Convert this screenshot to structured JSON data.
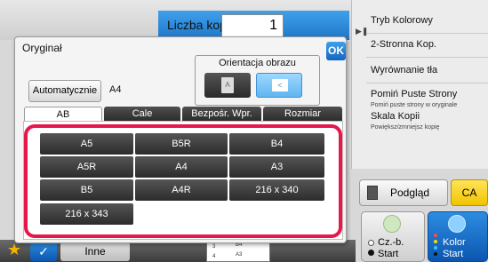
{
  "copies": {
    "label": "Liczba kopii",
    "value": "1"
  },
  "right_panel": {
    "items": [
      {
        "label": "Tryb Kolorowy",
        "sub": ""
      },
      {
        "label": "2-Stronna Kop.",
        "sub": ""
      },
      {
        "label": "Wyrównanie tła",
        "sub": ""
      },
      {
        "label": "Pomiń Puste Strony",
        "sub": "Pomiń puste strony w oryginale"
      },
      {
        "label": "Skala Kopii",
        "sub": "Powiększ/zmniejsz kopię"
      }
    ],
    "preview_label": "Podgląd",
    "ca_label": "CA",
    "bw_start_label": "Cz.-b.",
    "bw_start_sub": "Start",
    "color_start_label": "Kolor",
    "color_start_sub": "Start"
  },
  "dialog": {
    "title": "Oryginał",
    "ok_label": "OK",
    "auto_label": "Automatycznie",
    "auto_value": "A4",
    "orientation_label": "Orientacja obrazu",
    "tabs": [
      "AB",
      "Cale",
      "Bezpośr. Wpr.",
      "Rozmiar Niestand."
    ],
    "sizes": [
      "A5",
      "B5R",
      "B4",
      "A5R",
      "A4",
      "A3",
      "B5",
      "A4R",
      "216 x 340",
      "216 x 343"
    ]
  },
  "bottom": {
    "inne_label": "Inne",
    "thumb_lines": [
      "B4",
      "A3"
    ],
    "thumb_nums": [
      "3",
      "4"
    ]
  },
  "colors": {
    "accent": "#1f76c8",
    "highlight": "#e5174b",
    "ca": "#f1c400"
  }
}
